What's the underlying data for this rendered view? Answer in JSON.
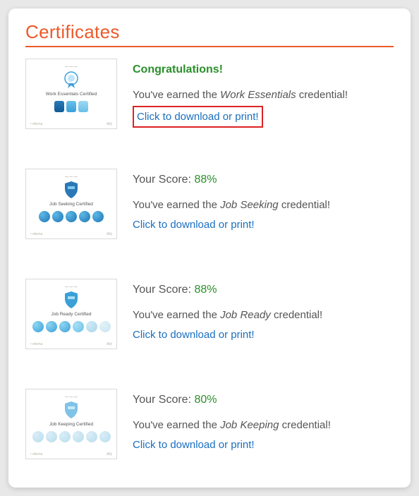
{
  "section_title": "Certificates",
  "download_label": "Click to download or print!",
  "earned_prefix": "You've earned the ",
  "earned_suffix": " credential!",
  "score_label": "Your Score: ",
  "certs": [
    {
      "headline": "Congratulations!",
      "headline_type": "congrats",
      "credential": "Work Essentials",
      "thumb_label": "Work Essentials Certified",
      "highlight_link": true,
      "score": null
    },
    {
      "headline_type": "score",
      "score": "88%",
      "credential": "Job Seeking",
      "thumb_label": "Job Seeking Certified",
      "highlight_link": false
    },
    {
      "headline_type": "score",
      "score": "88%",
      "credential": "Job Ready",
      "thumb_label": "Job Ready Certified",
      "highlight_link": false
    },
    {
      "headline_type": "score",
      "score": "80%",
      "credential": "Job Keeping",
      "thumb_label": "Job Keeping Certified",
      "highlight_link": false
    }
  ]
}
